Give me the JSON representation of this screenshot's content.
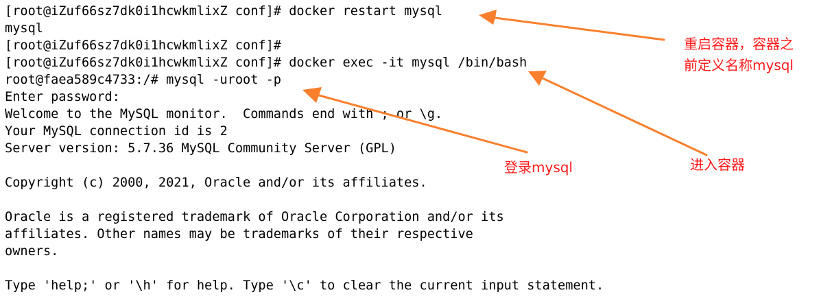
{
  "terminal": {
    "lines": [
      "[root@iZuf66sz7dk0i1hcwkmlixZ conf]# docker restart mysql",
      "mysql",
      "[root@iZuf66sz7dk0i1hcwkmlixZ conf]#",
      "[root@iZuf66sz7dk0i1hcwkmlixZ conf]# docker exec -it mysql /bin/bash",
      "root@faea589c4733:/# mysql -uroot -p",
      "Enter password:",
      "Welcome to the MySQL monitor.  Commands end with ; or \\g.",
      "Your MySQL connection id is 2",
      "Server version: 5.7.36 MySQL Community Server (GPL)",
      "",
      "Copyright (c) 2000, 2021, Oracle and/or its affiliates.",
      "",
      "Oracle is a registered trademark of Oracle Corporation and/or its",
      "affiliates. Other names may be trademarks of their respective",
      "owners.",
      "",
      "Type 'help;' or '\\h' for help. Type '\\c' to clear the current input statement."
    ]
  },
  "annotations": {
    "restart_note_line1": "重启容器，容器之",
    "restart_note_line2": "前定义名称mysql",
    "login_note": "登录mysql",
    "enter_note": "进入容器"
  },
  "colors": {
    "arrow": "#fa7f2c",
    "annotation_text": "#ff1a1a",
    "terminal_text": "#000000",
    "terminal_background": "#ffffff"
  }
}
